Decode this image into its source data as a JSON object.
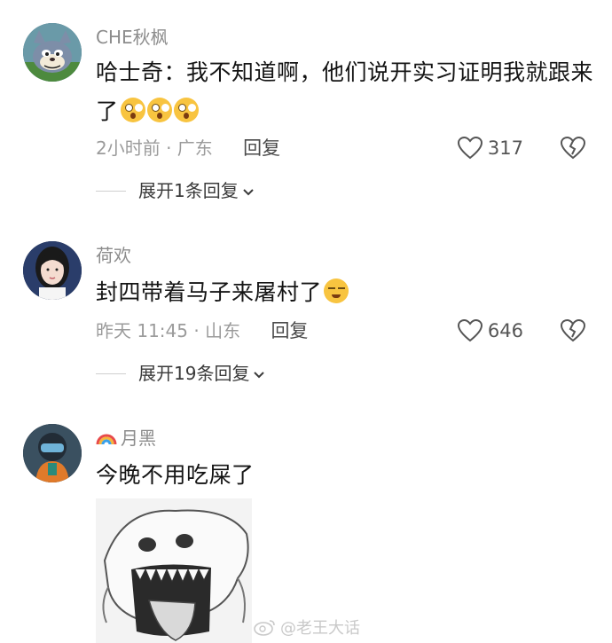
{
  "comments": [
    {
      "username": "CHE秋枫",
      "text": "哈士奇：我不知道啊，他们说开实习证明我就跟来了",
      "emojis": [
        "face-emoji",
        "face-emoji",
        "face-emoji"
      ],
      "time_location": "2小时前 · 广东",
      "reply_label": "回复",
      "likes": "317",
      "expand_label": "展开1条回复"
    },
    {
      "username": "荷欢",
      "text": "封四带着马子来屠村了",
      "emojis": [
        "sweat-face-emoji"
      ],
      "time_location": "昨天 11:45 · 山东",
      "reply_label": "回复",
      "likes": "646",
      "expand_label": "展开19条回复"
    },
    {
      "username": "月黑",
      "username_prefix_icon": "rainbow-icon",
      "text": "今晚不用吃屎了",
      "has_image": true
    }
  ],
  "watermark": "@老王大话",
  "colors": {
    "meta_gray": "#9b9b9b",
    "text": "#141414",
    "emoji_yellow": "#f8c440"
  }
}
